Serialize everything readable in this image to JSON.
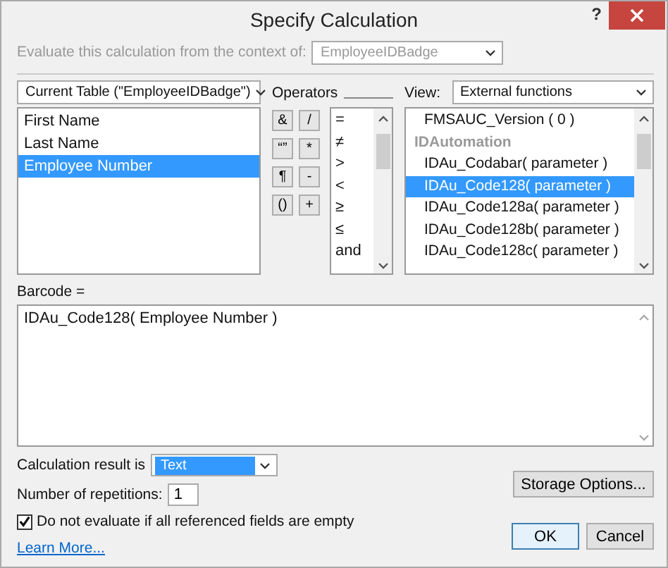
{
  "window": {
    "title": "Specify Calculation",
    "help": "?"
  },
  "context": {
    "label": "Evaluate this calculation from the context of:",
    "value": "EmployeeIDBadge",
    "disabled": true
  },
  "table_select": {
    "value": "Current Table (\"EmployeeIDBadge\")"
  },
  "fields": [
    {
      "label": "First Name",
      "selected": false
    },
    {
      "label": "Last Name",
      "selected": false
    },
    {
      "label": "Employee Number",
      "selected": true
    }
  ],
  "operators": {
    "label": "Operators",
    "buttons": [
      "&",
      "/",
      "“”",
      "*",
      "¶",
      "-",
      "()",
      "+"
    ],
    "list": [
      "=",
      "≠",
      ">",
      "<",
      "≥",
      "≤",
      "and"
    ]
  },
  "view": {
    "label": "View:",
    "value": "External functions"
  },
  "functions": [
    {
      "kind": "item",
      "label": "FMSAUC_Version ( 0 )",
      "selected": false
    },
    {
      "kind": "header",
      "label": "IDAutomation"
    },
    {
      "kind": "item",
      "label": "IDAu_Codabar( parameter )",
      "selected": false
    },
    {
      "kind": "item",
      "label": "IDAu_Code128( parameter )",
      "selected": true
    },
    {
      "kind": "item",
      "label": "IDAu_Code128a( parameter )",
      "selected": false
    },
    {
      "kind": "item",
      "label": "IDAu_Code128b( parameter )",
      "selected": false
    },
    {
      "kind": "item",
      "label": "IDAu_Code128c( parameter )",
      "selected": false
    }
  ],
  "formula": {
    "label": "Barcode =",
    "value": "IDAu_Code128( Employee Number )"
  },
  "result": {
    "label": "Calculation result is",
    "value": "Text"
  },
  "repetitions": {
    "label": "Number of repetitions:",
    "value": "1"
  },
  "do_not_evaluate": {
    "label": "Do not evaluate if all referenced fields are empty",
    "checked": true
  },
  "learn_more": "Learn More...",
  "buttons": {
    "storage": "Storage Options...",
    "ok": "OK",
    "cancel": "Cancel"
  }
}
